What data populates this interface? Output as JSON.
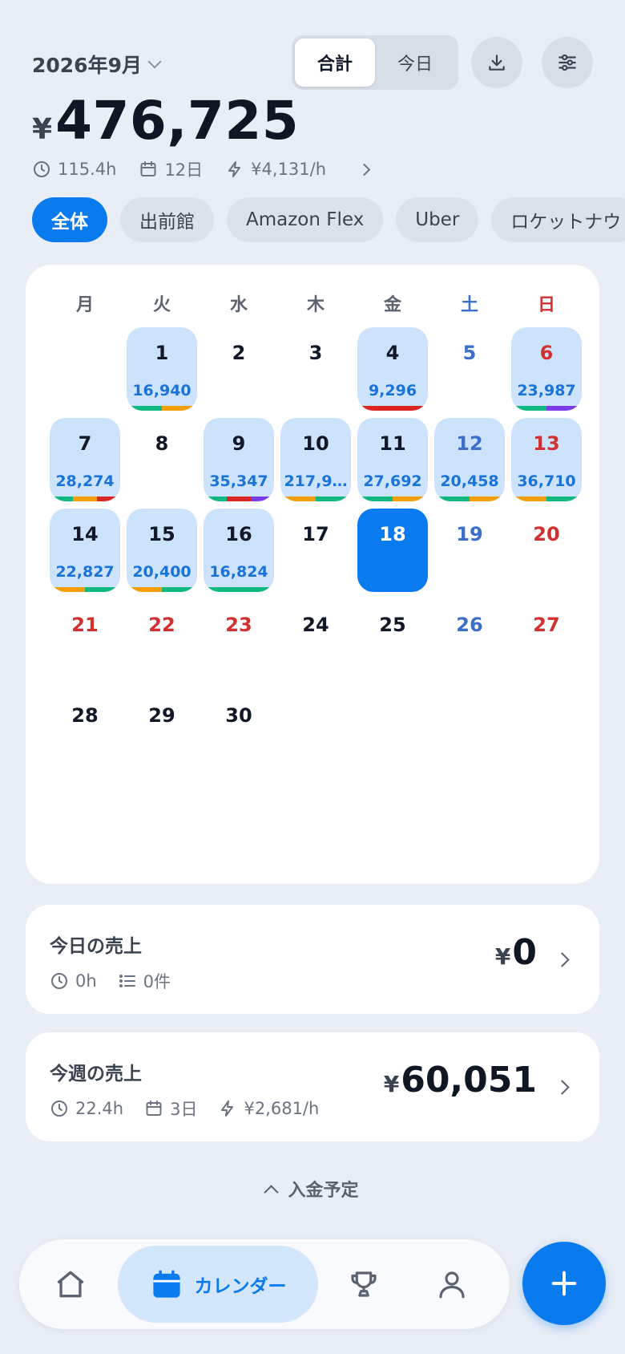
{
  "header": {
    "month": "2026年9月",
    "segment": {
      "total": "合計",
      "today": "今日",
      "active": "total"
    },
    "total_currency": "¥",
    "total_amount": "476,725",
    "stats": {
      "hours": "115.4h",
      "days": "12日",
      "rate": "¥4,131/h"
    }
  },
  "chips": [
    {
      "label": "全体",
      "active": true
    },
    {
      "label": "出前館",
      "active": false
    },
    {
      "label": "Amazon Flex",
      "active": false
    },
    {
      "label": "Uber",
      "active": false
    },
    {
      "label": "ロケットナウ",
      "active": false
    }
  ],
  "calendar": {
    "weekdays": [
      "月",
      "火",
      "水",
      "木",
      "金",
      "土",
      "日"
    ],
    "leading_blank_days": 1,
    "days": [
      {
        "day": "1",
        "amount": "16,940",
        "bar": [
          [
            "#10b981",
            0.5
          ],
          [
            "#f59e0b",
            0.5
          ]
        ]
      },
      {
        "day": "2"
      },
      {
        "day": "3"
      },
      {
        "day": "4",
        "amount": "9,296",
        "bar": [
          [
            "#dc2626",
            1.0
          ]
        ]
      },
      {
        "day": "5",
        "type": "sat"
      },
      {
        "day": "6",
        "type": "sun",
        "amount": "23,987",
        "bar": [
          [
            "#10b981",
            0.5
          ],
          [
            "#7c3aed",
            0.5
          ]
        ]
      },
      {
        "day": "7",
        "amount": "28,274",
        "bar": [
          [
            "#10b981",
            0.33
          ],
          [
            "#f59e0b",
            0.34
          ],
          [
            "#dc2626",
            0.33
          ]
        ]
      },
      {
        "day": "8"
      },
      {
        "day": "9",
        "amount": "35,347",
        "bar": [
          [
            "#10b981",
            0.33
          ],
          [
            "#dc2626",
            0.34
          ],
          [
            "#7c3aed",
            0.33
          ]
        ]
      },
      {
        "day": "10",
        "amount": "217,9…",
        "bar": [
          [
            "#f59e0b",
            0.5
          ],
          [
            "#10b981",
            0.5
          ]
        ]
      },
      {
        "day": "11",
        "amount": "27,692",
        "bar": [
          [
            "#10b981",
            0.5
          ],
          [
            "#f59e0b",
            0.5
          ]
        ]
      },
      {
        "day": "12",
        "type": "sat",
        "amount": "20,458",
        "bar": [
          [
            "#10b981",
            0.5
          ],
          [
            "#f59e0b",
            0.5
          ]
        ]
      },
      {
        "day": "13",
        "type": "sun",
        "amount": "36,710",
        "bar": [
          [
            "#f59e0b",
            0.5
          ],
          [
            "#10b981",
            0.5
          ]
        ]
      },
      {
        "day": "14",
        "amount": "22,827",
        "bar": [
          [
            "#f59e0b",
            0.5
          ],
          [
            "#10b981",
            0.5
          ]
        ]
      },
      {
        "day": "15",
        "amount": "20,400",
        "bar": [
          [
            "#f59e0b",
            0.5
          ],
          [
            "#10b981",
            0.5
          ]
        ]
      },
      {
        "day": "16",
        "amount": "16,824",
        "bar": [
          [
            "#10b981",
            1.0
          ]
        ]
      },
      {
        "day": "17"
      },
      {
        "day": "18",
        "type": "today"
      },
      {
        "day": "19",
        "type": "sat"
      },
      {
        "day": "20",
        "type": "sun"
      },
      {
        "day": "21",
        "type": "sun"
      },
      {
        "day": "22",
        "type": "sun"
      },
      {
        "day": "23",
        "type": "sun"
      },
      {
        "day": "24"
      },
      {
        "day": "25"
      },
      {
        "day": "26",
        "type": "sat"
      },
      {
        "day": "27",
        "type": "sun"
      },
      {
        "day": "28"
      },
      {
        "day": "29"
      },
      {
        "day": "30"
      }
    ]
  },
  "today_card": {
    "title": "今日の売上",
    "hours": "0h",
    "count": "0件",
    "currency": "¥",
    "amount": "0"
  },
  "week_card": {
    "title": "今週の売上",
    "hours": "22.4h",
    "days": "3日",
    "rate": "¥2,681/h",
    "currency": "¥",
    "amount": "60,051"
  },
  "payout_label": "入金予定",
  "nav": {
    "calendar_label": "カレンダー"
  },
  "colors": {
    "accent": "#0a7bef",
    "cell_bg": "#cde3fb",
    "amount_text": "#1a73d9",
    "saturday": "#3b6fc9",
    "sunday": "#d0302f"
  },
  "icons": [
    "chevron-down-icon",
    "download-icon",
    "sliders-icon",
    "clock-icon",
    "calendar-icon",
    "bolt-icon",
    "chevron-right-icon",
    "list-icon",
    "chevron-up-icon",
    "home-icon",
    "trophy-icon",
    "user-icon",
    "plus-icon"
  ]
}
